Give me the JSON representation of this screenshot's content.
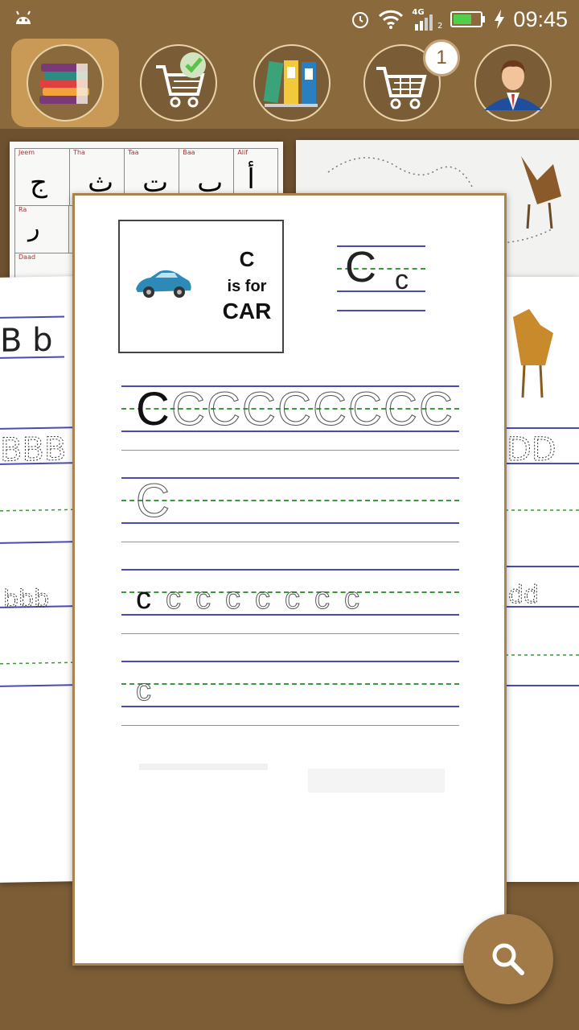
{
  "statusbar": {
    "time": "09:45",
    "network": "4G",
    "sim": "2"
  },
  "nav": {
    "tabs": [
      {
        "icon": "books-icon",
        "active": true
      },
      {
        "icon": "cart-check-icon"
      },
      {
        "icon": "folders-icon"
      },
      {
        "icon": "cart-icon",
        "badge": "1"
      },
      {
        "icon": "profile-avatar-icon"
      }
    ]
  },
  "background_cards": {
    "arabic_grid": {
      "headers": [
        "Jeem",
        "Tha",
        "Taa",
        "Baa",
        "Alif"
      ],
      "letters": [
        "ج",
        "ث",
        "ت",
        "ب",
        "أ"
      ],
      "second_row_labels": [
        "Ra"
      ],
      "second_row_letters": [
        "ر"
      ],
      "third_row_labels": [
        "Daad"
      ]
    }
  },
  "worksheet": {
    "letter_upper": "C",
    "caption_is_for": "is for",
    "caption_word": "CAR",
    "sample_upper": "C",
    "sample_lower": "c",
    "row1": [
      "C",
      "C",
      "C",
      "C",
      "C",
      "C",
      "C",
      "C",
      "C"
    ],
    "row2": [
      "C"
    ],
    "row3": [
      "c",
      "c",
      "c",
      "c",
      "c",
      "c",
      "c",
      "c"
    ],
    "row4": [
      "c"
    ]
  },
  "colors": {
    "brand_brown": "#8a6a3c",
    "active_tab": "#c89a55",
    "fab": "#a17a48",
    "guide_line": "#4a4ab5",
    "dash_line": "#3a9a3a"
  },
  "fab": {
    "icon": "search-icon"
  }
}
